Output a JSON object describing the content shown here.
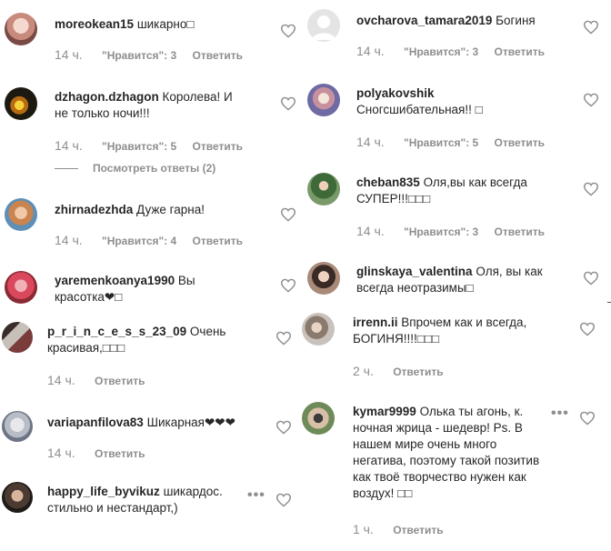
{
  "left_comments": [
    {
      "username": "moreokean15",
      "text": "шикарно□",
      "time": "14 ч.",
      "likes": "\"Нравится\": 3",
      "reply": "Ответить"
    },
    {
      "username": "dzhagon.dzhagon",
      "text": "Королева! И",
      "text2": "не только ночи!!!",
      "time": "14 ч.",
      "likes": "\"Нравится\": 5",
      "reply": "Ответить",
      "view_replies": "Посмотреть ответы (2)"
    },
    {
      "username": "zhirnadezhda",
      "text": "Дуже гарна!",
      "time": "14 ч.",
      "likes": "\"Нравится\": 4",
      "reply": "Ответить"
    },
    {
      "username": "yaremenkoanya1990",
      "text": "Вы",
      "text2": "красотка❤□"
    },
    {
      "username": "p_r_i_n_c_e_s_s_23_09",
      "text": "Очень",
      "text2": "красивая,□□□",
      "time": "14 ч.",
      "reply": "Ответить"
    },
    {
      "username": "variapanfilova83",
      "text": "Шикарная❤❤❤",
      "time": "14 ч.",
      "reply": "Ответить"
    },
    {
      "username": "happy_life_byvikuz",
      "text": "шикардос.",
      "text2": "стильно и нестандарт,)",
      "dots": "•••"
    }
  ],
  "right_comments": [
    {
      "username": "ovcharova_tamara2019",
      "text": "Богиня",
      "time": "14 ч.",
      "likes": "\"Нравится\": 3",
      "reply": "Ответить"
    },
    {
      "username": "polyakovshik",
      "text2": "Сногсшибательная!! □",
      "time": "14 ч.",
      "likes": "\"Нравится\": 5",
      "reply": "Ответить"
    },
    {
      "username": "cheban835",
      "text": "Оля,вы как всегда",
      "text2": "СУПЕР!!!□□□",
      "time": "14 ч.",
      "likes": "\"Нравится\": 3",
      "reply": "Ответить"
    },
    {
      "username": "glinskaya_valentina",
      "text": "Оля, вы как",
      "text2": "всегда неотразимы□"
    },
    {
      "username": "irrenn.ii",
      "text": "Впрочем как и всегда,",
      "text2": "БОГИНЯ!!!!□□□",
      "time": "2 ч.",
      "reply": "Ответить"
    },
    {
      "username": "kymar9999",
      "text": "Олька ты агонь, к.",
      "text2": "ночная жрица - шедевр! Ps. В",
      "text3": "нашем мире очень много",
      "text4": "негатива, поэтому такой позитив",
      "text5": "как твоё творчество нужен как",
      "text6": "воздух! □□",
      "time": "1 ч.",
      "reply": "Ответить",
      "dots": "•••"
    }
  ],
  "icons": {
    "like": "heart-outline-icon",
    "more": "more-dots-icon"
  },
  "colors": {
    "text": "#262626",
    "muted": "#8e8e8e",
    "background": "#ffffff"
  }
}
